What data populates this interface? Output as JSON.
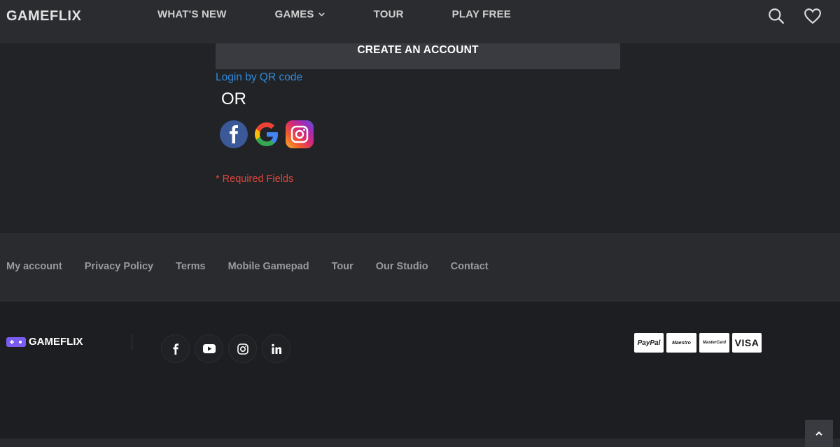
{
  "header": {
    "logo": "GAMEFLIX",
    "nav": [
      {
        "label": "WHAT'S NEW"
      },
      {
        "label": "GAMES"
      },
      {
        "label": "TOUR"
      },
      {
        "label": "PLAY FREE"
      }
    ],
    "icons": [
      "search-icon",
      "heart-icon"
    ]
  },
  "form": {
    "create_account_label": "CREATE AN ACCOUNT",
    "qr_login_label": "Login by QR code",
    "or_label": "OR",
    "social_logins": [
      "facebook-icon",
      "google-icon",
      "instagram-icon"
    ],
    "required_note": "* Required Fields"
  },
  "footer": {
    "links": [
      "My account",
      "Privacy Policy",
      "Terms",
      "Mobile Gamepad",
      "Tour",
      "Our Studio",
      "Contact"
    ],
    "logo": "GAMEFLIX",
    "social": [
      "facebook-icon",
      "youtube-icon",
      "instagram-icon",
      "linkedin-icon"
    ],
    "payments": [
      "PayPal",
      "Maestro",
      "MasterCard",
      "VISA"
    ]
  },
  "colors": {
    "background": "#222327",
    "header": "#2b2c30",
    "button": "#3a3b40",
    "link": "#2f8bdc",
    "required": "#e0453a"
  }
}
